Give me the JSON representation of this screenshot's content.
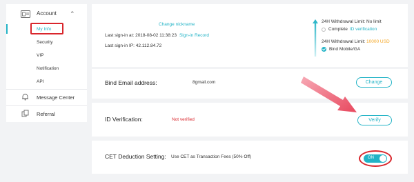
{
  "sidebar": {
    "account_label": "Account",
    "items": [
      {
        "label": "My Info",
        "active": true
      },
      {
        "label": "Security"
      },
      {
        "label": "VIP"
      },
      {
        "label": "Notification"
      },
      {
        "label": "API"
      }
    ],
    "message_center_label": "Message Center",
    "referral_label": "Referral"
  },
  "profile": {
    "change_nickname": "Change nickname",
    "last_signin_at_label": "Last sign-in at: 2018-08-02 11:38:23",
    "signin_record_link": "Sign-in Record",
    "last_signin_ip_label": "Last sign-in IP: 42.112.84.72"
  },
  "limits": {
    "limit1": "24H Withdrawal Limit: No limit",
    "complete_prefix": "Complete",
    "complete_link": "ID verification",
    "limit2_prefix": "24H Withdrawal Limit:",
    "limit2_value": "10000 USD",
    "bind_label": "Bind Mobile/GA"
  },
  "email": {
    "title": "Bind Email address:",
    "value": "8gmail.com",
    "button": "Change"
  },
  "id_verification": {
    "title": "ID Verification:",
    "status": "Not verified",
    "button": "Verify"
  },
  "cet": {
    "title": "CET Deduction Setting:",
    "description": "Use CET as Transaction Fees (50% Off)",
    "toggle_label": "ON",
    "toggle_on": true
  },
  "colors": {
    "accent": "#22b3c6",
    "danger": "#d9262c",
    "warning": "#f5a623"
  }
}
